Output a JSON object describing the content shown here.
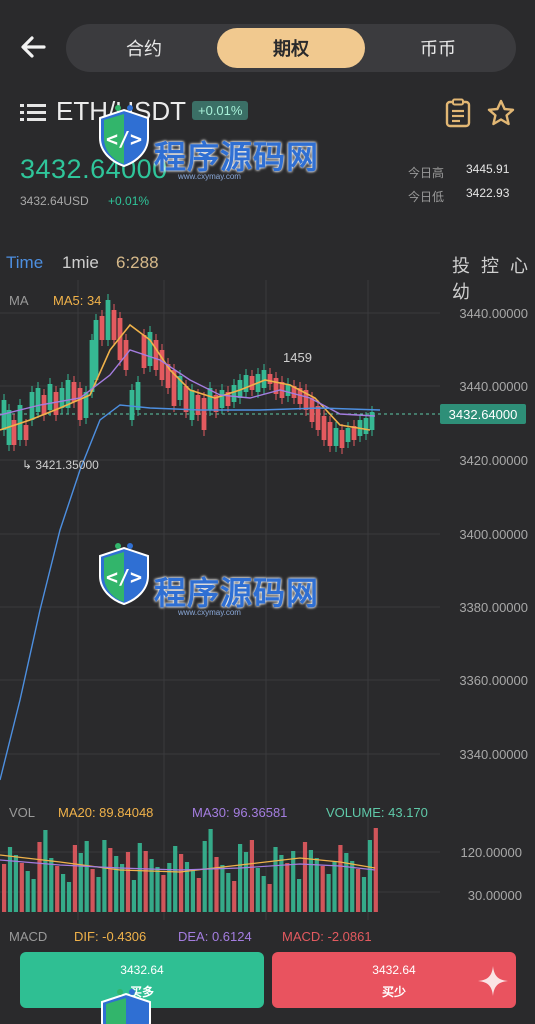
{
  "header": {
    "tabs": [
      {
        "label": "合约",
        "active": false
      },
      {
        "label": "期权",
        "active": true
      },
      {
        "label": "币币",
        "active": false
      }
    ]
  },
  "ticker": {
    "pair": "ETH/USDT",
    "change_badge": "+0.01%",
    "price": "3432.64000",
    "price_usd": "3432.64USD",
    "price_change": "+0.01%",
    "high_label": "今日高",
    "high_value": "3445.91",
    "low_label": "今日低",
    "low_value": "3422.93"
  },
  "timeframe": {
    "time": "Time",
    "interval": "1mie",
    "clock": "6:288",
    "right": "投 控 心  幼"
  },
  "indicators": {
    "ma": "MA",
    "ma5": "MA5: 34"
  },
  "chart_data": {
    "type": "candlestick",
    "y_ticks": [
      "3440.00000",
      "3440.00000",
      "3420.00000",
      "3400.00000",
      "3380.00000",
      "3360.00000",
      "3340.00000"
    ],
    "current_price_label": "3432.64000",
    "low_annotation": "3421.35000",
    "high_annotation": "1459",
    "vol_ticks": [
      "120.00000",
      "30.00000"
    ],
    "colors": {
      "up": "#36b893",
      "down": "#e35a5f",
      "ma5": "#f0b24a",
      "ma10": "#a47de0",
      "ma_blue": "#4d8fe0"
    }
  },
  "volume": {
    "vol": "VOL",
    "ma20": "MA20: 89.84048",
    "ma30": "MA30: 96.36581",
    "volume": "VOLUME: 43.170"
  },
  "macd": {
    "macd": "MACD",
    "dif": "DIF: -0.4306",
    "dea": "DEA: 0.6124",
    "macd_val": "MACD: -2.0861"
  },
  "actions": {
    "buy_price": "3432.64",
    "buy_label": "买多",
    "sell_price": "3432.64",
    "sell_label": "买少"
  },
  "watermark": {
    "text": "程序源码网",
    "url": "www.cxymay.com"
  }
}
